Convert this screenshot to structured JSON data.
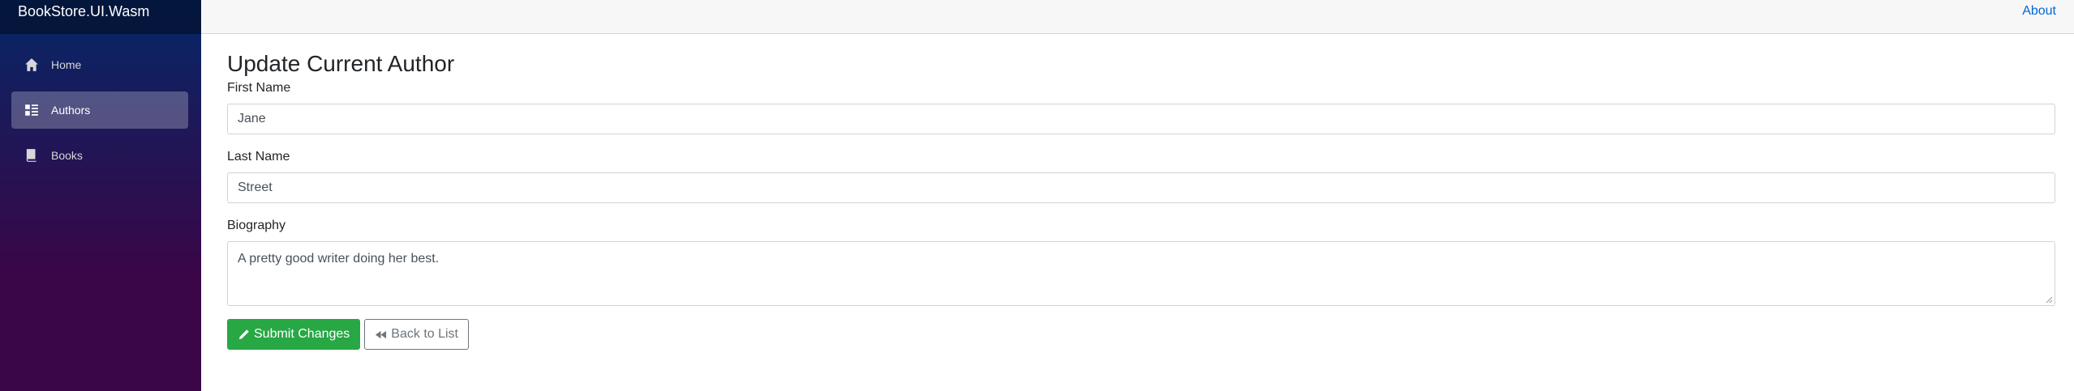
{
  "app": {
    "brand": "BookStore.UI.Wasm"
  },
  "sidebar": {
    "items": [
      {
        "label": "Home",
        "icon": "home-icon",
        "active": false
      },
      {
        "label": "Authors",
        "icon": "list-icon",
        "active": true
      },
      {
        "label": "Books",
        "icon": "book-icon",
        "active": false
      }
    ]
  },
  "topbar": {
    "about": "About"
  },
  "page": {
    "title": "Update Current Author",
    "fields": {
      "first_name": {
        "label": "First Name",
        "value": "Jane"
      },
      "last_name": {
        "label": "Last Name",
        "value": "Street"
      },
      "biography": {
        "label": "Biography",
        "value": "A pretty good writer doing her best."
      }
    },
    "buttons": {
      "submit": "Submit Changes",
      "back": "Back to List"
    }
  },
  "colors": {
    "accent": "#0366d6",
    "success": "#28a745",
    "sidebar_top": "#052767",
    "sidebar_bottom": "#3a0647"
  }
}
